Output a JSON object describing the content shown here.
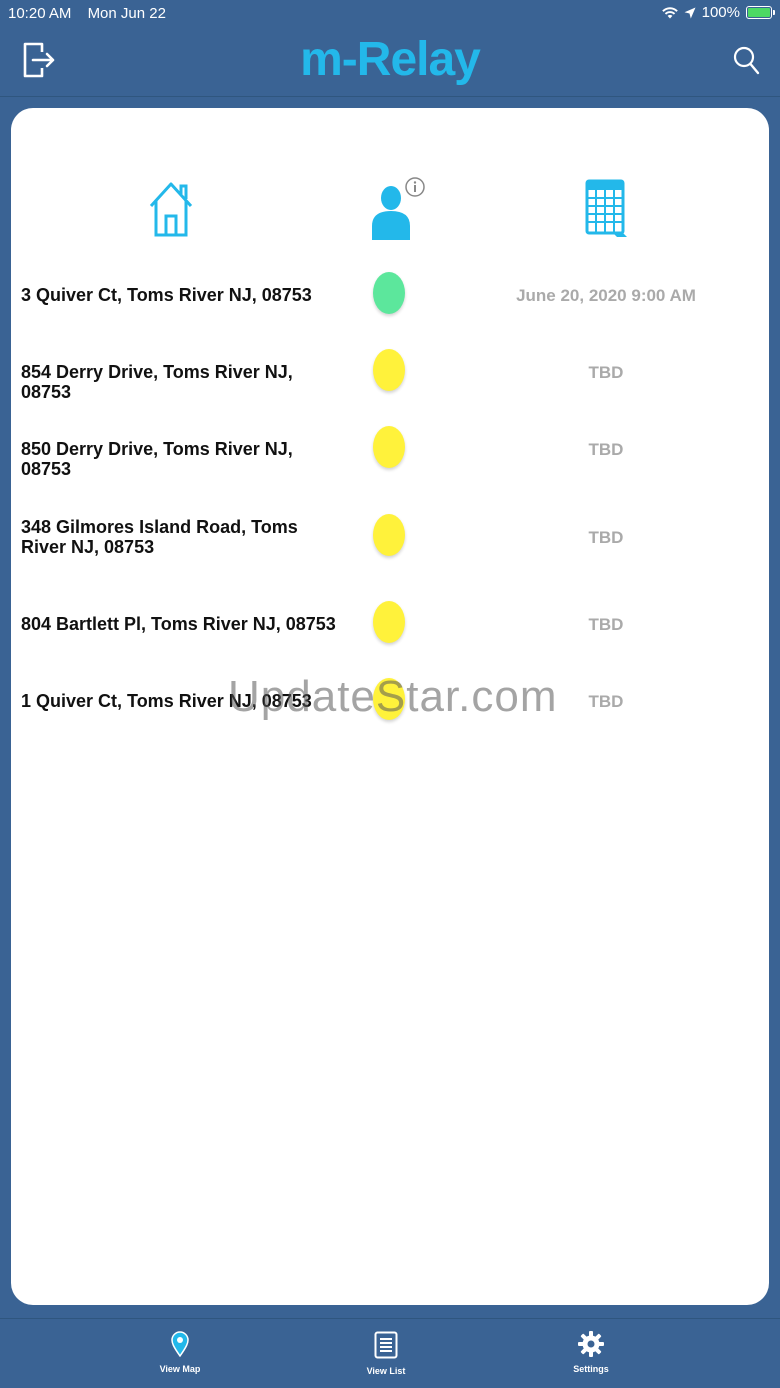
{
  "status_bar": {
    "time": "10:20 AM",
    "date": "Mon Jun 22",
    "battery": "100%"
  },
  "header": {
    "title": "m-Relay",
    "left_icon": "logout-icon",
    "right_icon": "search-icon"
  },
  "columns": {
    "address_icon": "home-icon",
    "status_icon": "user-info-icon",
    "date_icon": "calendar-icon"
  },
  "colors": {
    "accent": "#23b8ea",
    "background": "#3a6394",
    "status_green": "#5ce79c",
    "status_yellow": "#fff23b"
  },
  "rows": [
    {
      "address": "3 Quiver Ct, Toms River NJ, 08753",
      "status": "green",
      "date": "June 20, 2020 9:00 AM"
    },
    {
      "address": "854 Derry Drive, Toms River NJ, 08753",
      "status": "yellow",
      "date": "TBD"
    },
    {
      "address": "850 Derry Drive, Toms River NJ, 08753",
      "status": "yellow",
      "date": "TBD"
    },
    {
      "address": "348 Gilmores Island Road, Toms River NJ, 08753",
      "status": "yellow",
      "date": "TBD"
    },
    {
      "address": "804 Bartlett Pl, Toms River NJ, 08753",
      "status": "yellow",
      "date": "TBD"
    },
    {
      "address": "1 Quiver Ct, Toms River NJ, 08753",
      "status": "yellow",
      "date": "TBD"
    }
  ],
  "watermark": "UpdateStar.com",
  "tabbar": {
    "map_label": "View Map",
    "list_label": "View List",
    "settings_label": "Settings"
  }
}
